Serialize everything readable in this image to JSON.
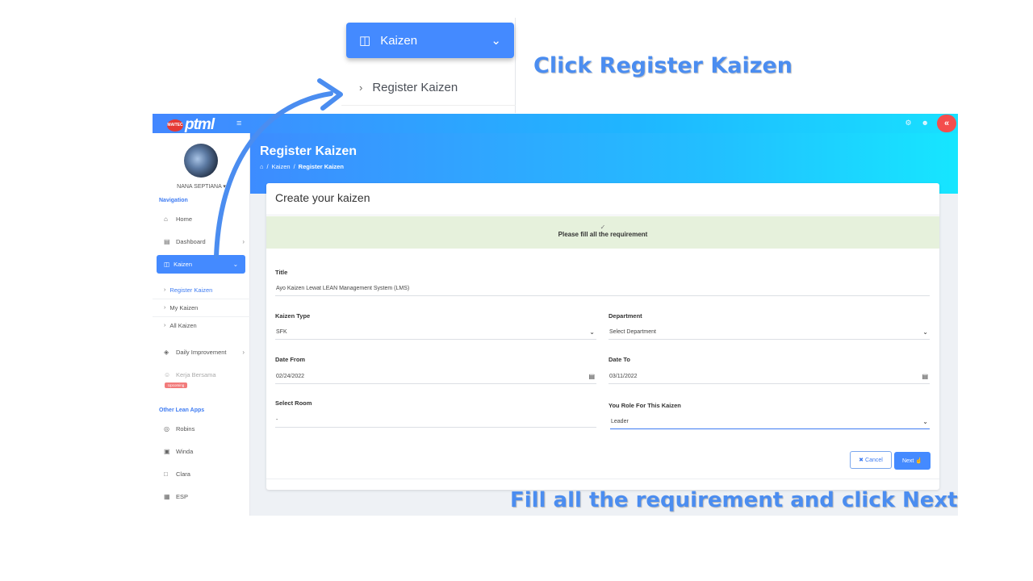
{
  "callouts": {
    "top": "Click Register Kaizen",
    "bottom": "Fill all the requirement and click Next"
  },
  "zoom": {
    "kaizen_label": "Kaizen",
    "register_label": "Register Kaizen"
  },
  "topbar": {
    "logo_badge": "MAITEC",
    "logo_word": "ptml"
  },
  "sidebar": {
    "username": "NANA SEPTIANA ▾",
    "nav_heading": "Navigation",
    "home": "Home",
    "dashboard": "Dashboard",
    "kaizen": "Kaizen",
    "sub_items": [
      "Register Kaizen",
      "My Kaizen",
      "All Kaizen"
    ],
    "daily_improvement": "Daily Improvement",
    "kerja_bersama": "Kerja Bersama",
    "upcoming_badge": "Upcoming",
    "other_heading": "Other Lean Apps",
    "other_items": [
      "Robins",
      "Winda",
      "Clara",
      "ESP"
    ]
  },
  "page": {
    "title": "Register Kaizen",
    "breadcrumb": [
      "Kaizen",
      "Register Kaizen"
    ]
  },
  "form": {
    "card_title": "Create your kaizen",
    "alert": "Please fill all the requirement",
    "title_label": "Title",
    "title_value": "Ayo Kaizen Lewat LEAN Management System (LMS)",
    "kaizen_type_label": "Kaizen Type",
    "kaizen_type_value": "SFK",
    "department_label": "Department",
    "department_value": "Select Department",
    "date_from_label": "Date From",
    "date_from_value": "02/24/2022",
    "date_to_label": "Date To",
    "date_to_value": "03/11/2022",
    "room_label": "Select Room",
    "room_value": "-",
    "role_label": "You Role For This Kaizen",
    "role_value": "Leader",
    "cancel_label": "Cancel",
    "next_label": "Next"
  },
  "colors": {
    "accent": "#448aff",
    "callout": "#4b8df0",
    "alert_bg": "#e6f1dc",
    "collapse": "#f44d4d"
  }
}
